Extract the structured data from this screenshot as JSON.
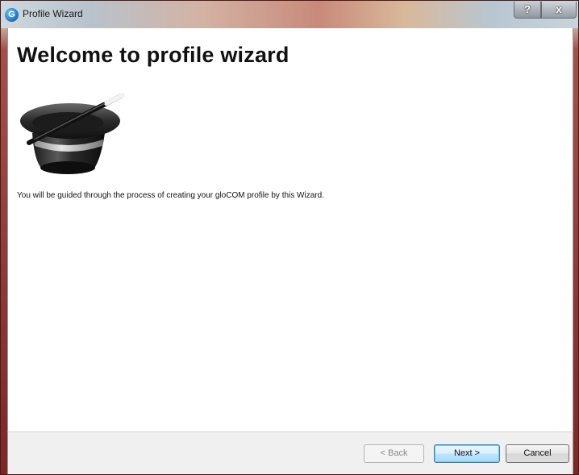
{
  "window": {
    "title": "Profile Wizard",
    "app_icon_letter": "G",
    "help_label": "?",
    "close_label": "x"
  },
  "page": {
    "heading": "Welcome to profile wizard",
    "description": "You will be guided through the process of creating your gloCOM profile by this Wizard.",
    "illustration": "magic-hat-icon"
  },
  "buttons": {
    "back": "< Back",
    "back_enabled": false,
    "next": "Next >",
    "cancel": "Cancel"
  },
  "colors": {
    "accent_button_border": "#3c7fb1",
    "app_icon_blue": "#1a6fb8"
  }
}
